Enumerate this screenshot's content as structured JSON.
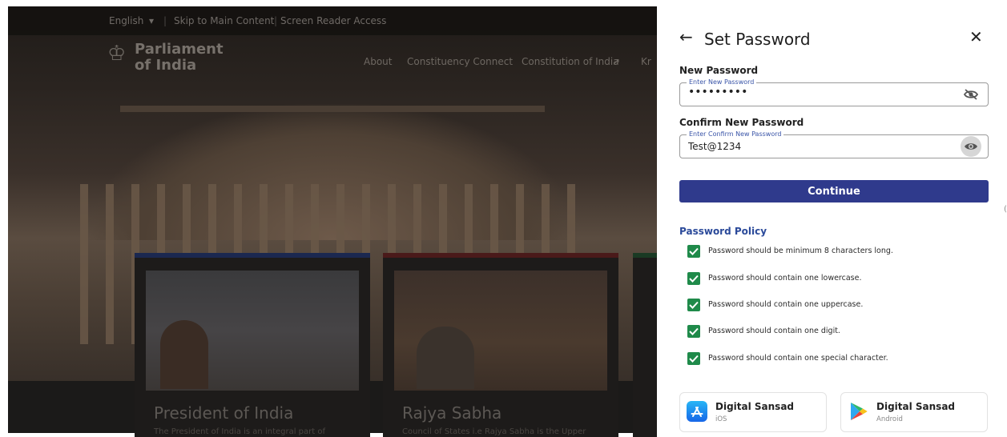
{
  "background": {
    "topbar": {
      "language": "English",
      "skip_link": "Skip to Main Content",
      "screen_reader": "Screen Reader Access"
    },
    "logo": {
      "line1": "Parliament",
      "line2": "of India"
    },
    "nav": [
      "About",
      "Constituency Connect",
      "Constitution of India",
      "Kr"
    ],
    "cards": [
      {
        "title": "President of India",
        "subtitle": "The President of India is an integral part of"
      },
      {
        "title": "Rajya Sabha",
        "subtitle": "Council of States i.e Rajya Sabha is the Upper"
      }
    ]
  },
  "panel": {
    "title": "Set Password",
    "new_password": {
      "label": "New Password",
      "legend": "Enter New Password",
      "value": "•••••••••"
    },
    "confirm_password": {
      "label": "Confirm New Password",
      "legend": "Enter Confirm New Password",
      "value": "Test@1234"
    },
    "continue_label": "Continue",
    "policy": {
      "title": "Password Policy",
      "items": [
        "Password should be minimum 8 characters long.",
        "Password should contain one lowercase.",
        "Password should contain one uppercase.",
        "Password should contain one digit.",
        "Password should contain one special character."
      ]
    },
    "apps": [
      {
        "name": "Digital Sansad",
        "os": "iOS"
      },
      {
        "name": "Digital Sansad",
        "os": "Android"
      }
    ]
  },
  "colors": {
    "primary_button": "#2f3a8c",
    "policy_title": "#2b4a9a",
    "check_green": "#1f8a4a"
  }
}
